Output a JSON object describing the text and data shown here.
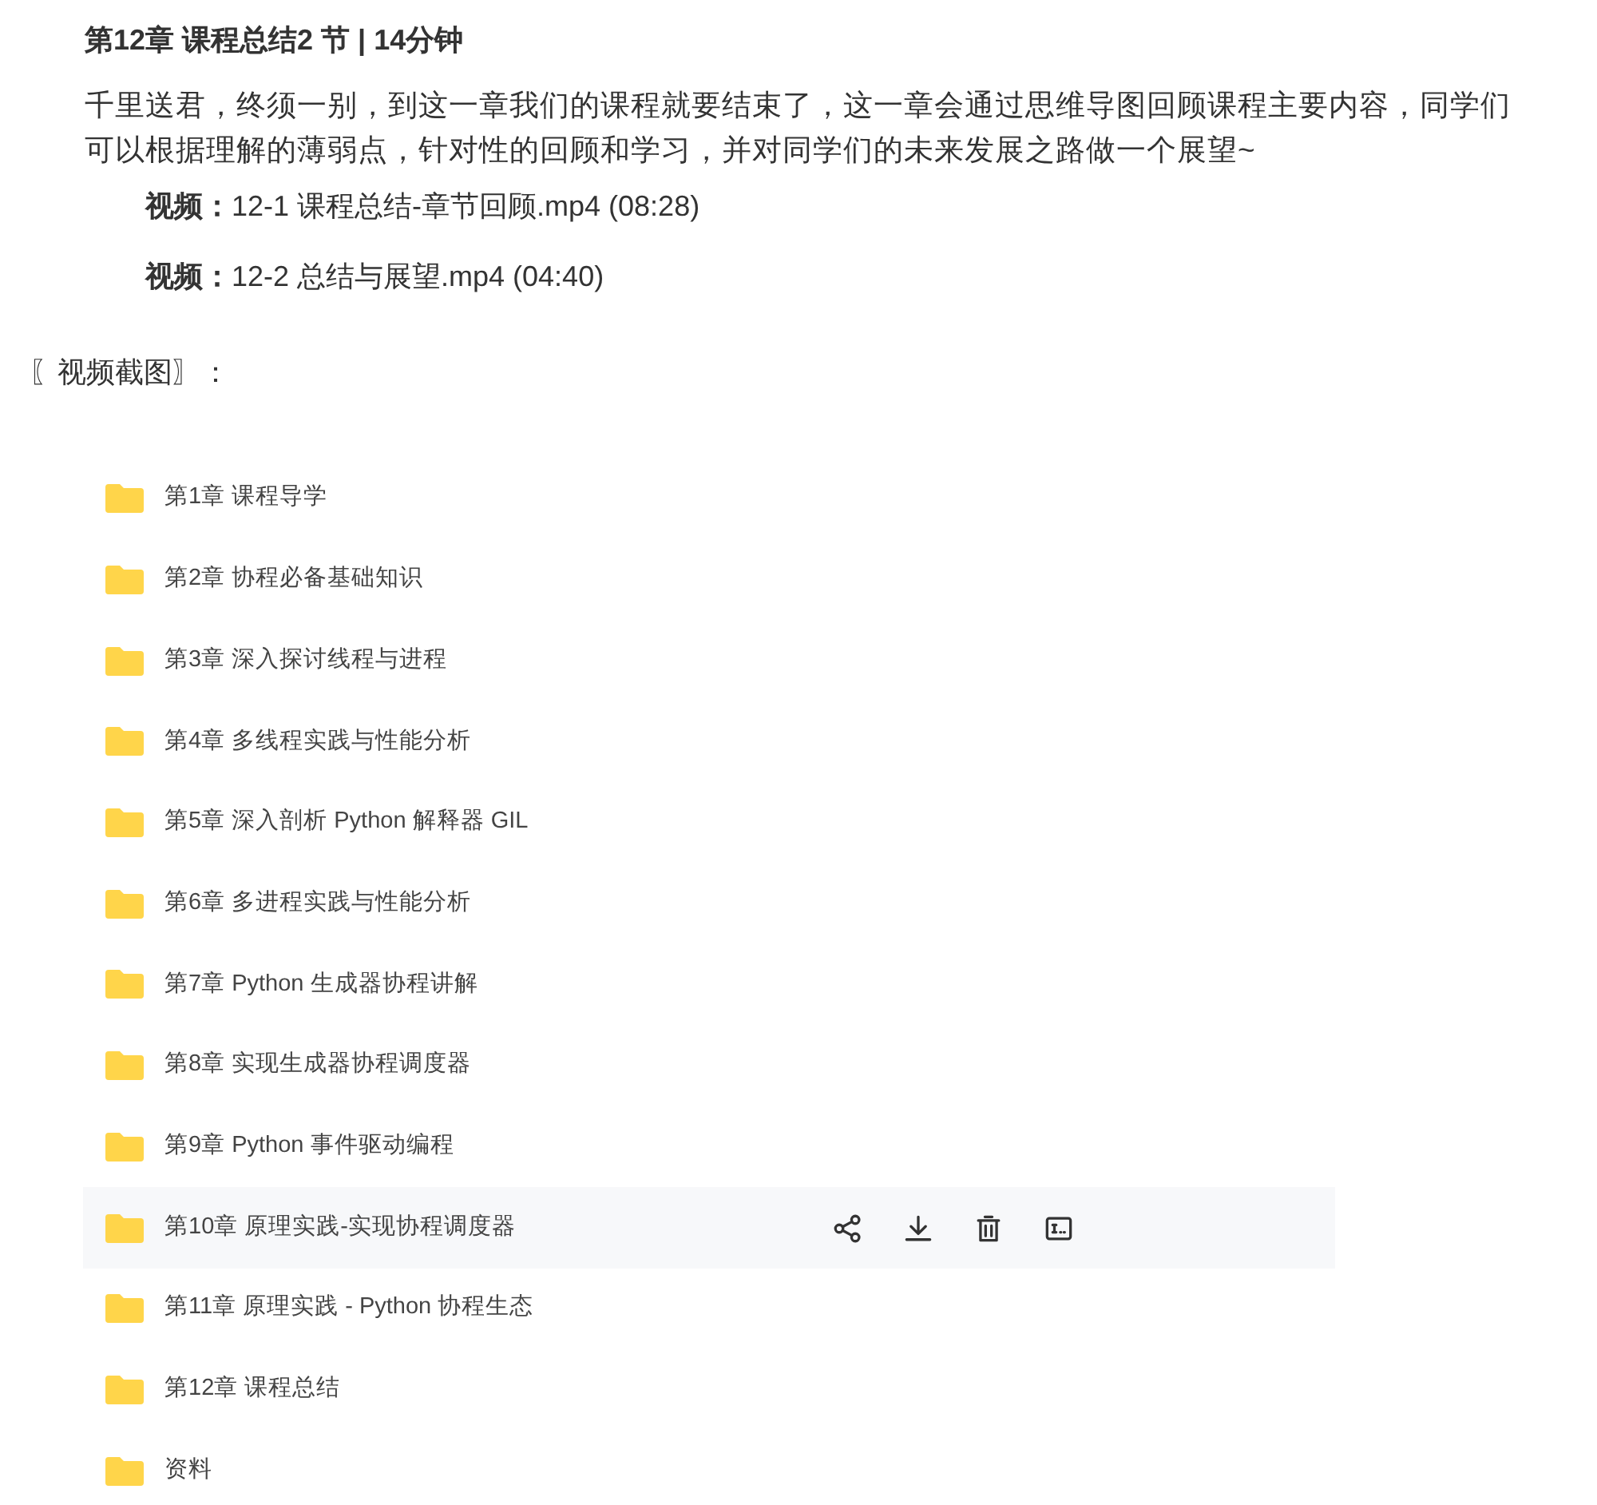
{
  "heading": "第12章 课程总结2 节 | 14分钟",
  "description": "千里送君，终须一别，到这一章我们的课程就要结束了，这一章会通过思维导图回顾课程主要内容，同学们可以根据理解的薄弱点，针对性的回顾和学习，并对同学们的未来发展之路做一个展望~",
  "videos": [
    "**视频：**12-1 课程总结-章节回顾.mp4 (08:28)",
    "**视频：**12-2 总结与展望.mp4 (04:40)"
  ],
  "screenshot_label": "〖视频截图〗：",
  "folders": [
    {
      "name": "第1章 课程导学",
      "hovered": false
    },
    {
      "name": "第2章 协程必备基础知识",
      "hovered": false
    },
    {
      "name": "第3章 深入探讨线程与进程",
      "hovered": false
    },
    {
      "name": "第4章 多线程实践与性能分析",
      "hovered": false
    },
    {
      "name": "第5章 深入剖析 Python 解释器 GIL",
      "hovered": false
    },
    {
      "name": "第6章 多进程实践与性能分析",
      "hovered": false
    },
    {
      "name": "第7章 Python 生成器协程讲解",
      "hovered": false
    },
    {
      "name": "第8章 实现生成器协程调度器",
      "hovered": false
    },
    {
      "name": "第9章 Python 事件驱动编程",
      "hovered": false
    },
    {
      "name": "第10章 原理实践-实现协程调度器",
      "hovered": true
    },
    {
      "name": "第11章 原理实践 - Python 协程生态",
      "hovered": false
    },
    {
      "name": "第12章 课程总结",
      "hovered": false
    },
    {
      "name": "资料",
      "hovered": false
    }
  ]
}
